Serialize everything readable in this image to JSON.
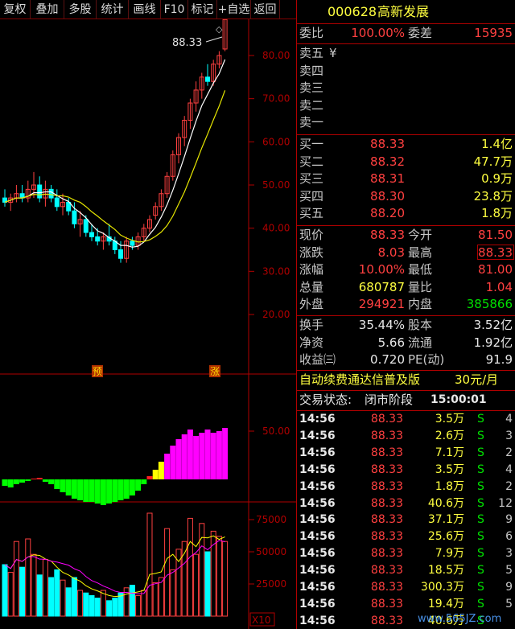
{
  "toolbar": {
    "items": [
      "复权",
      "叠加",
      "多股",
      "统计",
      "画线",
      "F10",
      "标记",
      "+自选",
      "返回"
    ]
  },
  "stock": {
    "code": "000628",
    "name": "高新发展"
  },
  "main_chart": {
    "price_axis": [
      "80.00",
      "70.00",
      "60.00",
      "50.00",
      "40.00",
      "30.00",
      "20.00"
    ],
    "high_label": "88.33",
    "marker_yu": "预",
    "marker_zhang": "涨"
  },
  "indicator_chart": {
    "axis": [
      "50.00"
    ]
  },
  "volume_chart": {
    "axis": [
      "75000",
      "50000",
      "25000"
    ],
    "unit": "X10"
  },
  "order_ratio": {
    "wei_bi_label": "委比",
    "wei_bi_value": "100.00%",
    "wei_cha_label": "委差",
    "wei_cha_value": "15935"
  },
  "sell_book": [
    {
      "label": "卖五",
      "price": "",
      "vol": "",
      "mark": "¥"
    },
    {
      "label": "卖四",
      "price": "",
      "vol": ""
    },
    {
      "label": "卖三",
      "price": "",
      "vol": ""
    },
    {
      "label": "卖二",
      "price": "",
      "vol": ""
    },
    {
      "label": "卖一",
      "price": "",
      "vol": ""
    }
  ],
  "buy_book": [
    {
      "label": "买一",
      "price": "88.33",
      "vol": "1.4亿"
    },
    {
      "label": "买二",
      "price": "88.32",
      "vol": "47.7万"
    },
    {
      "label": "买三",
      "price": "88.31",
      "vol": "0.9万"
    },
    {
      "label": "买四",
      "price": "88.30",
      "vol": "23.8万"
    },
    {
      "label": "买五",
      "price": "88.20",
      "vol": "1.8万"
    }
  ],
  "quote": {
    "xianjia_label": "现价",
    "xianjia": "88.33",
    "jinkai_label": "今开",
    "jinkai": "81.50",
    "zhangdie_label": "涨跌",
    "zhangdie": "8.03",
    "zuigao_label": "最高",
    "zuigao": "88.33",
    "zhangfu_label": "涨幅",
    "zhangfu": "10.00%",
    "zuidi_label": "最低",
    "zuidi": "81.00",
    "zongliang_label": "总量",
    "zongliang": "680787",
    "liangbi_label": "量比",
    "liangbi": "1.04",
    "waipan_label": "外盘",
    "waipan": "294921",
    "neipan_label": "内盘",
    "neipan": "385866"
  },
  "fundamentals": {
    "huanshou_label": "换手",
    "huanshou": "35.44%",
    "guben_label": "股本",
    "guben": "3.52亿",
    "jingzi_label": "净资",
    "jingzi": "5.66",
    "liutong_label": "流通",
    "liutong": "1.92亿",
    "shouyi_label": "收益㈢",
    "shouyi": "0.720",
    "pe_label": "PE(动)",
    "pe": "91.9"
  },
  "ad": {
    "text": "自动续费通达信普及版",
    "price": "30元/月"
  },
  "trade_status": {
    "label": "交易状态:",
    "status": "闭市阶段",
    "time": "15:00:01"
  },
  "trades": [
    {
      "time": "14:56",
      "price": "88.33",
      "vol": "3.5万",
      "side": "S",
      "n": "4"
    },
    {
      "time": "14:56",
      "price": "88.33",
      "vol": "2.6万",
      "side": "S",
      "n": "3"
    },
    {
      "time": "14:56",
      "price": "88.33",
      "vol": "7.1万",
      "side": "S",
      "n": "2"
    },
    {
      "time": "14:56",
      "price": "88.33",
      "vol": "3.5万",
      "side": "S",
      "n": "4"
    },
    {
      "time": "14:56",
      "price": "88.33",
      "vol": "1.8万",
      "side": "S",
      "n": "2"
    },
    {
      "time": "14:56",
      "price": "88.33",
      "vol": "40.6万",
      "side": "S",
      "n": "12"
    },
    {
      "time": "14:56",
      "price": "88.33",
      "vol": "37.1万",
      "side": "S",
      "n": "9"
    },
    {
      "time": "14:56",
      "price": "88.33",
      "vol": "25.6万",
      "side": "S",
      "n": "6"
    },
    {
      "time": "14:56",
      "price": "88.33",
      "vol": "7.9万",
      "side": "S",
      "n": "3"
    },
    {
      "time": "14:56",
      "price": "88.33",
      "vol": "18.5万",
      "side": "S",
      "n": "5"
    },
    {
      "time": "14:56",
      "price": "88.33",
      "vol": "300.3万",
      "side": "S",
      "n": "9"
    },
    {
      "time": "14:56",
      "price": "88.33",
      "vol": "19.4万",
      "side": "S",
      "n": "5"
    },
    {
      "time": "14:56",
      "price": "88.33",
      "vol": "40.6万",
      "side": "S",
      "n": ""
    }
  ],
  "watermark": "www.565JZ.com",
  "colors": {
    "up": "#ff4040",
    "down": "#00ffff",
    "ma5": "#ffffff",
    "ma10": "#e6e600",
    "macd_pos": "#ff00ff",
    "macd_neg": "#00ff00",
    "grid": "#b00000"
  }
}
